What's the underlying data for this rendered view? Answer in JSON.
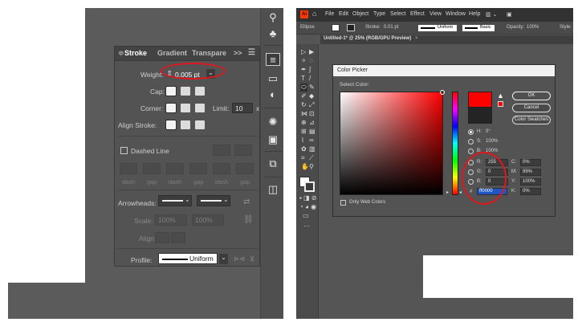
{
  "stroke_panel": {
    "tabs": [
      "Stroke",
      "Gradient",
      "Transpare"
    ],
    "tab_overflow": ">>",
    "menu_icon": "menu-icon",
    "weight_label": "Weight:",
    "weight_value": "0.005 pt",
    "cap_label": "Cap:",
    "corner_label": "Corner:",
    "limit_label": "Limit:",
    "limit_value": "10",
    "limit_unit": "x",
    "align_label": "Align Stroke:",
    "dashed_line_label": "Dashed Line",
    "dash_labels": [
      "dash",
      "gap",
      "dash",
      "gap",
      "dash",
      "gap"
    ],
    "arrowheads_label": "Arrowheads:",
    "scale_label": "Scale:",
    "scale_values": [
      "100%",
      "100%"
    ],
    "align_label2": "Align:",
    "profile_label": "Profile:",
    "profile_value": "Uniform"
  },
  "illustrator": {
    "app_icon": "Ai",
    "menus": [
      "File",
      "Edit",
      "Object",
      "Type",
      "Select",
      "Effect",
      "View",
      "Window",
      "Help"
    ],
    "control_bar": {
      "object": "Ellipse",
      "stroke_label": "Stroke:",
      "stroke_value": "0.01 pt",
      "uniform": "Uniform",
      "basic": "Basic",
      "opacity_label": "Opacity:",
      "opacity_value": "100%",
      "style_label": "Style:"
    },
    "doc_tab": "Untitled-1* @ 25% (RGB/GPU Preview)",
    "doc_tab_close": "×"
  },
  "color_picker": {
    "title": "Color Picker",
    "select_color_label": "Select Color:",
    "ok_label": "OK",
    "cancel_label": "Cancel",
    "swatches_label": "Color Swatches",
    "only_web_label": "Only Web Colors",
    "hsb": [
      {
        "label": "H:",
        "value": "0°",
        "selected": true
      },
      {
        "label": "S:",
        "value": "100%",
        "selected": false
      },
      {
        "label": "B:",
        "value": "100%",
        "selected": false
      }
    ],
    "rgb": [
      {
        "label": "R:",
        "value": "255"
      },
      {
        "label": "G:",
        "value": "0"
      },
      {
        "label": "B:",
        "value": "0"
      }
    ],
    "hex_label": "#",
    "hex_value": "ff0000",
    "cmyk": [
      {
        "label": "C:",
        "value": "0%"
      },
      {
        "label": "M:",
        "value": "99%"
      },
      {
        "label": "Y:",
        "value": "100%"
      },
      {
        "label": "K:",
        "value": "0%"
      }
    ],
    "current_color": "#ff0000",
    "previous_color": "#242424"
  }
}
